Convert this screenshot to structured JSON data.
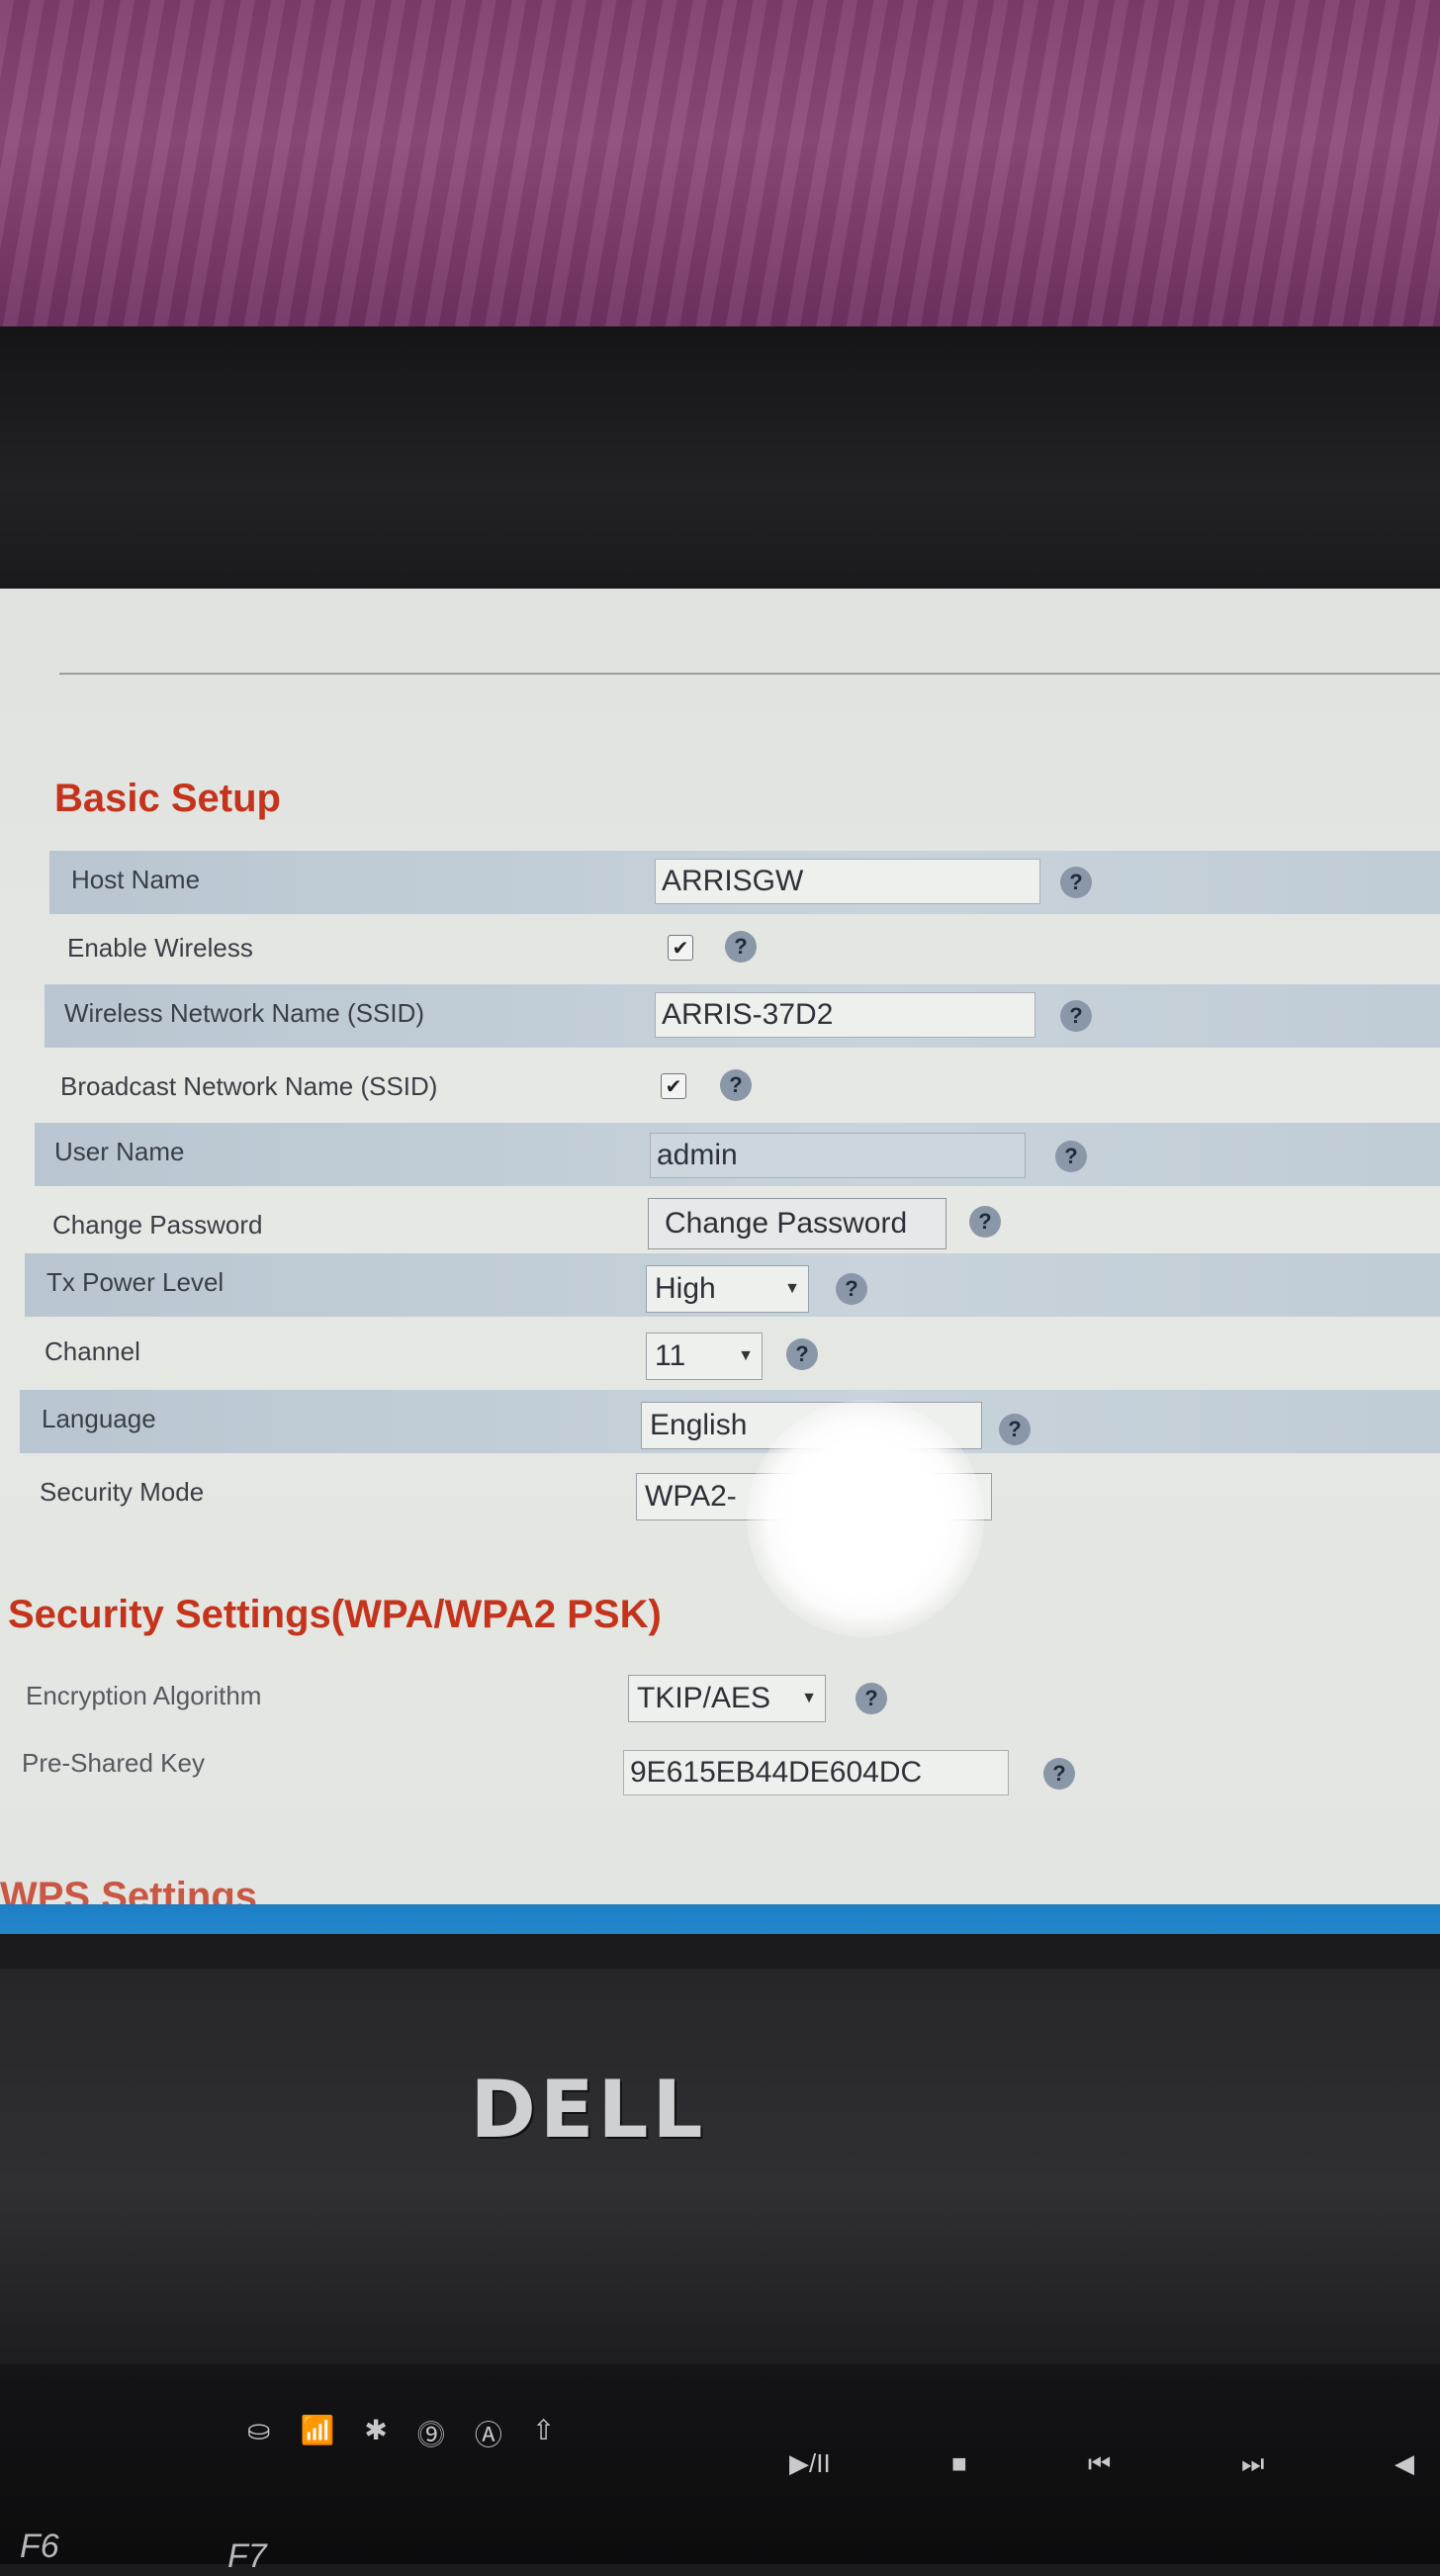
{
  "basic_setup": {
    "title": "Basic Setup",
    "host_name": {
      "label": "Host Name",
      "value": "ARRISGW"
    },
    "enable_wireless": {
      "label": "Enable Wireless",
      "checked": true
    },
    "ssid": {
      "label": "Wireless Network Name (SSID)",
      "value": "ARRIS-37D2"
    },
    "broadcast_ssid": {
      "label": "Broadcast Network Name (SSID)",
      "checked": true
    },
    "user_name": {
      "label": "User Name",
      "value": "admin"
    },
    "change_password": {
      "label": "Change Password",
      "button_label": "Change Password"
    },
    "tx_power": {
      "label": "Tx Power Level",
      "selected": "High"
    },
    "channel": {
      "label": "Channel",
      "selected": "11"
    },
    "language": {
      "label": "Language",
      "selected": "English"
    },
    "security_mode": {
      "label": "Security Mode",
      "selected": "WPA2-"
    }
  },
  "security_settings": {
    "title": "Security Settings(WPA/WPA2 PSK)",
    "encryption": {
      "label": "Encryption Algorithm",
      "selected": "TKIP/AES"
    },
    "psk": {
      "label": "Pre-Shared Key",
      "value": "9E615EB44DE604DC"
    }
  },
  "next_section": {
    "title": "WPS Settings"
  },
  "help_glyph": "?",
  "check_glyph": "✔",
  "dropdown_glyph": "▼",
  "device": {
    "brand": "DELL"
  },
  "keyboard": {
    "f6": "F6",
    "f7": "F7",
    "play_pause": "▶/II",
    "stop": "■",
    "prev": "⏮",
    "next": "⏭",
    "mute": "◀"
  },
  "colors": {
    "section_title": "#c4341c",
    "row_shade": "#b9c6d1",
    "taskbar": "#1d7ec4"
  }
}
